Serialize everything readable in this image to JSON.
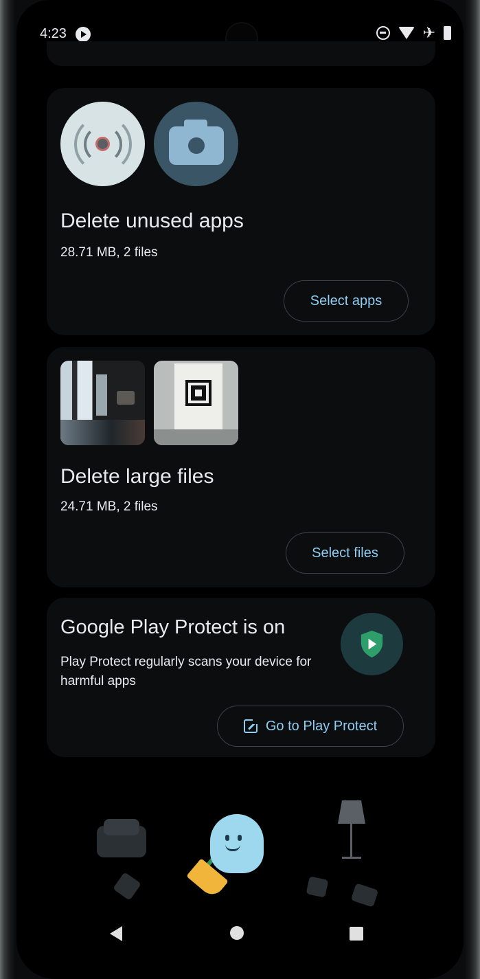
{
  "status_bar": {
    "time": "4:23"
  },
  "cards": {
    "unused_apps": {
      "title": "Delete unused apps",
      "subtitle": "28.71 MB, 2 files",
      "button_label": "Select apps",
      "thumbnails": [
        "radio-app-icon",
        "camera-app-icon"
      ]
    },
    "large_files": {
      "title": "Delete large files",
      "subtitle": "24.71 MB, 2 files",
      "button_label": "Select files",
      "thumbnails": [
        "photo-thumbnail",
        "photo-thumbnail"
      ]
    },
    "play_protect": {
      "title": "Google Play Protect is on",
      "description": "Play Protect regularly scans your device for harmful apps",
      "button_label": "Go to Play Protect",
      "icon": "play-protect-shield-icon"
    }
  },
  "navigation_bar": {
    "buttons": [
      "back",
      "home",
      "recents"
    ]
  },
  "colors": {
    "background": "#000000",
    "card": "#0b0d0f",
    "accent": "#8ecdf2",
    "text": "#e8eaed",
    "shield_green": "#2e9e6a"
  }
}
